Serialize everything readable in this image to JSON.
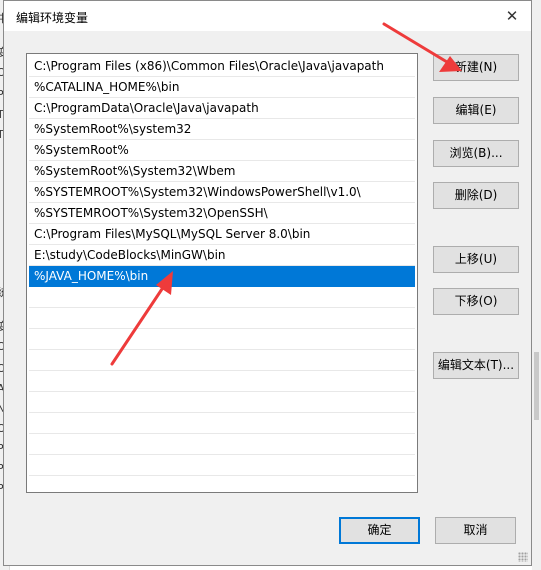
{
  "background_window": {
    "left_fragments": [
      "中",
      "变",
      "O",
      "Pa",
      "TE",
      "TM",
      "统",
      "变",
      "Or",
      "Or",
      "A",
      "N",
      "O",
      "Pa",
      "PA",
      "PR"
    ]
  },
  "dialog": {
    "title": "编辑环境变量",
    "close_glyph": "✕",
    "path_entries": [
      "C:\\Program Files (x86)\\Common Files\\Oracle\\Java\\javapath",
      "%CATALINA_HOME%\\bin",
      "C:\\ProgramData\\Oracle\\Java\\javapath",
      "%SystemRoot%\\system32",
      "%SystemRoot%",
      "%SystemRoot%\\System32\\Wbem",
      "%SYSTEMROOT%\\System32\\WindowsPowerShell\\v1.0\\",
      "%SYSTEMROOT%\\System32\\OpenSSH\\",
      "C:\\Program Files\\MySQL\\MySQL Server 8.0\\bin",
      "E:\\study\\CodeBlocks\\MinGW\\bin",
      "%JAVA_HOME%\\bin"
    ],
    "selected_index": 10,
    "buttons": {
      "new": "新建(N)",
      "edit": "编辑(E)",
      "browse": "浏览(B)...",
      "delete": "删除(D)",
      "move_up": "上移(U)",
      "move_down": "下移(O)",
      "edit_text": "编辑文本(T)...",
      "ok": "确定",
      "cancel": "取消"
    }
  },
  "colors": {
    "selection": "#0078d7",
    "annotation_arrow": "#ee3b3b"
  },
  "icons": {
    "close": "close-icon",
    "resize": "resize-grip-icon"
  }
}
